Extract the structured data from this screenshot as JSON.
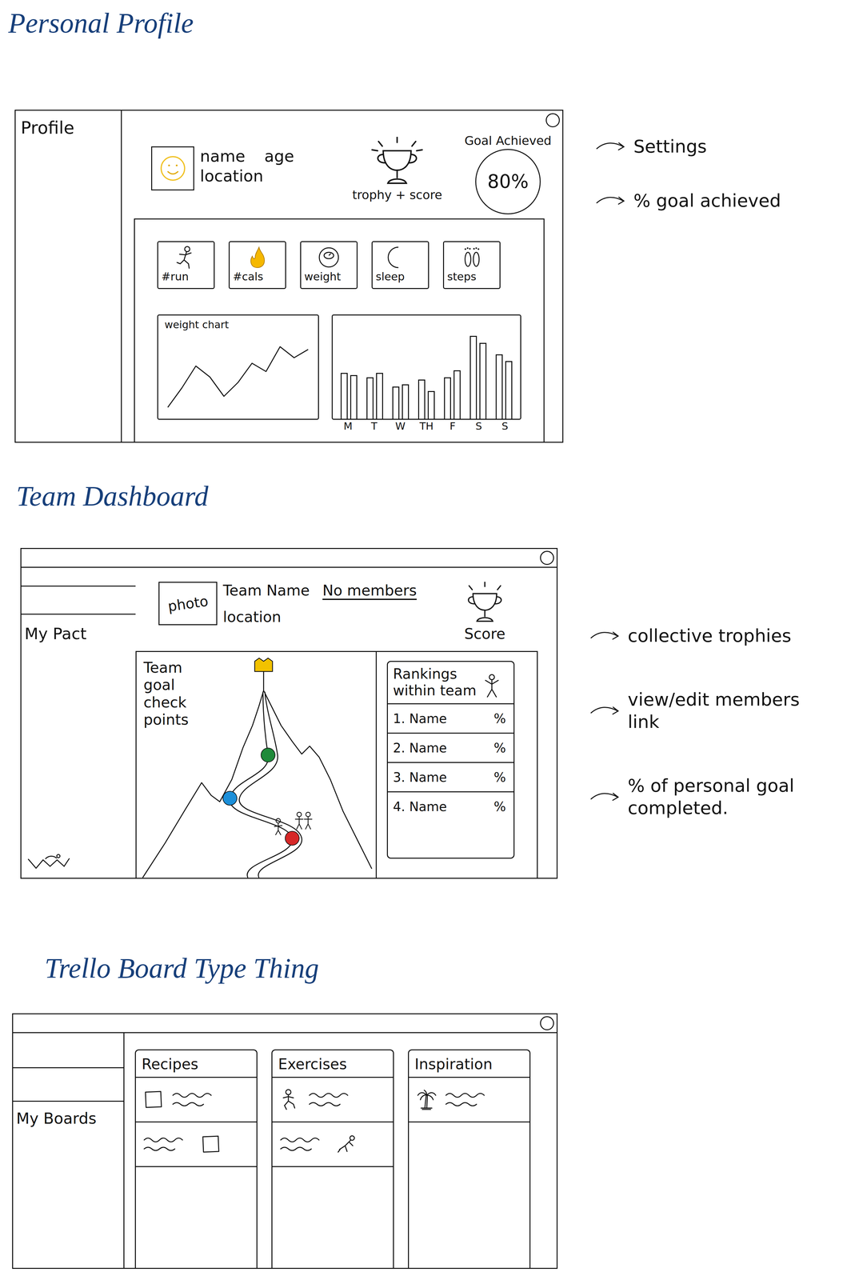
{
  "profile": {
    "heading": "Personal Profile",
    "sidebar_label": "Profile",
    "user": {
      "name": "name",
      "age": "age",
      "location": "location"
    },
    "trophy_caption": "trophy + score",
    "goal": {
      "label": "Goal Achieved",
      "value": "80%"
    },
    "stats": [
      {
        "label": "#run",
        "kind": "run"
      },
      {
        "label": "#cals",
        "kind": "calories"
      },
      {
        "label": "weight",
        "kind": "scale"
      },
      {
        "label": "sleep",
        "kind": "sleep"
      },
      {
        "label": "steps",
        "kind": "steps"
      }
    ],
    "weight_chart": {
      "title": "weight chart",
      "values": [
        8,
        22,
        38,
        30,
        16,
        26,
        40,
        34,
        52,
        44,
        50
      ]
    },
    "activity_chart": {
      "days": [
        "M",
        "T",
        "W",
        "TH",
        "F",
        "S",
        "S"
      ],
      "values": [
        40,
        38,
        36,
        40,
        28,
        30,
        34,
        24,
        36,
        42,
        72,
        66,
        56,
        50
      ]
    },
    "annotations": [
      "Settings",
      "% goal achieved"
    ]
  },
  "team": {
    "heading": "Team Dashboard",
    "sidebar_label": "My Pact",
    "photo_label": "photo",
    "name": "Team Name",
    "members_link": "No members",
    "location": "location",
    "score_label": "Score",
    "goal_panel": {
      "title": "Team goal check points",
      "checkpoints": [
        {
          "color": "#1f8a3a"
        },
        {
          "color": "#1c8fd9"
        },
        {
          "color": "#d62828"
        }
      ]
    },
    "rankings": {
      "title": "Rankings within team",
      "rows": [
        {
          "rank": "1.",
          "name": "Name",
          "percent": "%"
        },
        {
          "rank": "2.",
          "name": "Name",
          "percent": "%"
        },
        {
          "rank": "3.",
          "name": "Name",
          "percent": "%"
        },
        {
          "rank": "4.",
          "name": "Name",
          "percent": "%"
        }
      ]
    },
    "annotations": [
      "collective trophies",
      "view/edit members link",
      "% of personal goal completed."
    ]
  },
  "boards": {
    "heading": "Trello Board Type Thing",
    "sidebar_label": "My Boards",
    "columns": [
      {
        "title": "Recipes",
        "cards": [
          {
            "kind": "photo-left"
          },
          {
            "kind": "photo-right"
          }
        ]
      },
      {
        "title": "Exercises",
        "cards": [
          {
            "kind": "runner-left"
          },
          {
            "kind": "workout-right"
          }
        ]
      },
      {
        "title": "Inspiration",
        "cards": [
          {
            "kind": "palm-left"
          }
        ]
      }
    ]
  }
}
